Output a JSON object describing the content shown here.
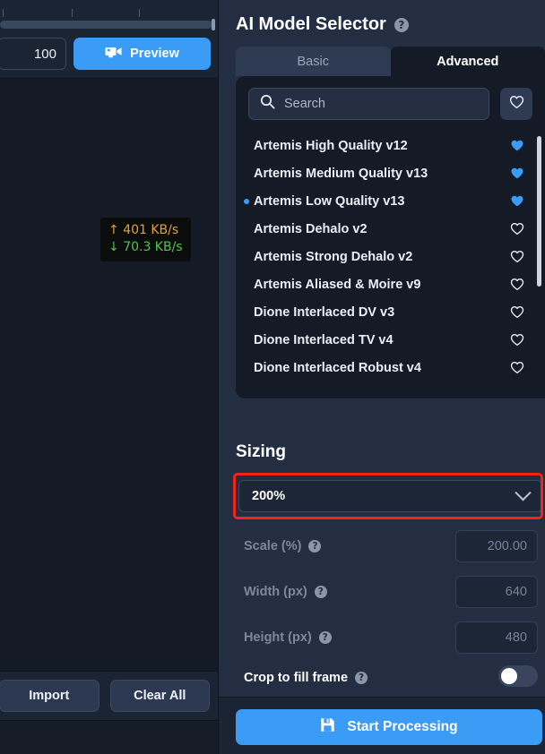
{
  "left": {
    "timeline": {
      "ticks": [
        2,
        80,
        155
      ],
      "icon": "timeline-slider"
    },
    "frame_value": "100",
    "preview_label": "Preview",
    "preview_icon": "video-camera-icon",
    "network": {
      "upload": "401 KB/s",
      "download": "70.3 KB/s",
      "up_arrow": "↑",
      "down_arrow": "↓",
      "up_color": "#e0a33a",
      "down_color": "#4fc64f"
    },
    "import_label": "Import",
    "clear_all_label": "Clear All"
  },
  "right": {
    "title": "AI Model Selector",
    "help_glyph": "?",
    "tabs": [
      {
        "label": "Basic",
        "active": false
      },
      {
        "label": "Advanced",
        "active": true
      }
    ],
    "search": {
      "placeholder": "Search",
      "value": "",
      "icon": "search-icon"
    },
    "favorites_icon": "heart-outline-icon",
    "models": [
      {
        "name": "Artemis High Quality v12",
        "favorite": true,
        "selected": false
      },
      {
        "name": "Artemis Medium Quality v13",
        "favorite": true,
        "selected": false
      },
      {
        "name": "Artemis Low Quality v13",
        "favorite": true,
        "selected": true
      },
      {
        "name": "Artemis Dehalo v2",
        "favorite": false,
        "selected": false
      },
      {
        "name": "Artemis Strong Dehalo v2",
        "favorite": false,
        "selected": false
      },
      {
        "name": "Artemis Aliased & Moire v9",
        "favorite": false,
        "selected": false
      },
      {
        "name": "Dione Interlaced DV v3",
        "favorite": false,
        "selected": false
      },
      {
        "name": "Dione Interlaced TV v4",
        "favorite": false,
        "selected": false
      },
      {
        "name": "Dione Interlaced Robust v4",
        "favorite": false,
        "selected": false
      }
    ],
    "sizing": {
      "title": "Sizing",
      "preset_value": "200%",
      "highlight_color": "#f42318",
      "fields": [
        {
          "label": "Scale (%)",
          "value": "200.00",
          "disabled": true
        },
        {
          "label": "Width (px)",
          "value": "640",
          "disabled": true
        },
        {
          "label": "Height (px)",
          "value": "480",
          "disabled": true
        }
      ],
      "crop_label": "Crop to fill frame",
      "crop_enabled": false
    },
    "start_label": "Start Processing",
    "start_icon": "save-floppy-icon",
    "accent_color": "#3b9cf5"
  }
}
